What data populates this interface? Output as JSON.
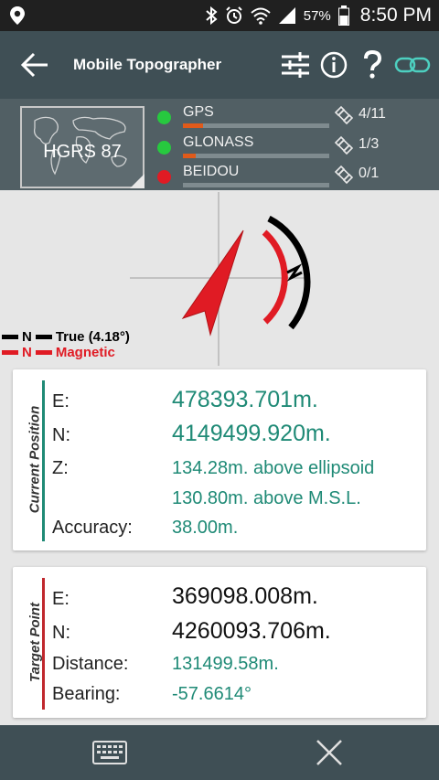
{
  "status_bar": {
    "battery": "57%",
    "time": "8:50 PM",
    "icons": [
      "location-icon",
      "bluetooth-icon",
      "alarm-icon",
      "wifi-icon",
      "signal-icon",
      "battery-icon"
    ]
  },
  "app_bar": {
    "title": "Mobile Topographer",
    "actions": [
      "settings-sliders-icon",
      "info-icon",
      "help-icon",
      "link-icon"
    ]
  },
  "satellites": {
    "datum": "HGRS 87",
    "systems": [
      {
        "name": "GPS",
        "status_color": "#27c93f",
        "count": "4/11",
        "signal": 0.14
      },
      {
        "name": "GLONASS",
        "status_color": "#27c93f",
        "count": "1/3",
        "signal": 0.09
      },
      {
        "name": "BEIDOU",
        "status_color": "#e01b24",
        "count": "0/1",
        "signal": 0
      }
    ]
  },
  "compass": {
    "legend": [
      {
        "letter": "N",
        "label": "True (4.18°)",
        "color": "#000000"
      },
      {
        "letter": "N",
        "label": "Magnetic",
        "color": "#e01b24"
      }
    ]
  },
  "current_position": {
    "title": "Current Position",
    "accent": "#1f8a76",
    "rows": [
      {
        "label": "E:",
        "value": "478393.701m."
      },
      {
        "label": "N:",
        "value": "4149499.920m."
      },
      {
        "label": "Z:",
        "value": "134.28m. above ellipsoid"
      },
      {
        "label": "",
        "value": "130.80m. above M.S.L."
      },
      {
        "label": "Accuracy:",
        "value": "38.00m."
      }
    ]
  },
  "target_point": {
    "title": "Target Point",
    "accent": "#c0272d",
    "rows": [
      {
        "label": "E:",
        "value": "369098.008m."
      },
      {
        "label": "N:",
        "value": "4260093.706m."
      },
      {
        "label": "Distance:",
        "value": "131499.58m."
      },
      {
        "label": "Bearing:",
        "value": "-57.6614°"
      }
    ]
  },
  "bottom_bar": {
    "actions": [
      "keyboard-icon",
      "close-icon"
    ]
  }
}
